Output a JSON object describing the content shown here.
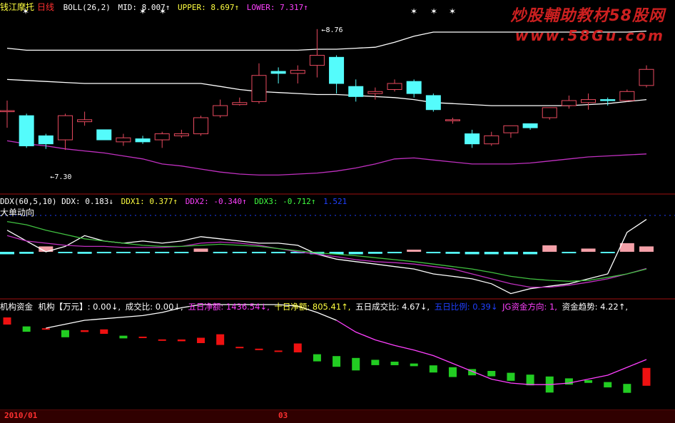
{
  "colors": {
    "background": "#000000",
    "up_candle": "#e84a5f",
    "down_candle": "#54fcfc",
    "white_line": "#ffffff",
    "magenta_line": "#c030c0",
    "green_line": "#40c040",
    "pink_line": "#ff40ff",
    "yellow_star": "#ffffff",
    "panel_divider": "#a01010",
    "label_white": "#ffffff",
    "label_red": "#ff3030",
    "label_yellow": "#ffff40",
    "label_magenta": "#ff40ff",
    "label_green": "#40ff40",
    "label_blue": "#2040ff",
    "watermark": "#cc2020",
    "bar_green": "#22cc22",
    "bar_red": "#ee1111"
  },
  "watermark": {
    "line1": "炒股輔助教材58股网",
    "line2": "www.58Gu.com"
  },
  "panel1": {
    "name_a": "钱江摩托",
    "name_b": "日线",
    "boll_label": "BOLL(26,2)",
    "mid_label": "MID: 8.007↑",
    "upper_label": "UPPER: 8.697↑",
    "lower_label": "LOWER: 7.317↑",
    "high_annotation": "8.76",
    "low_annotation": "7.30"
  },
  "panel2": {
    "ddx_label": "DDX(60,5,10) DDX: 0.183↓",
    "ddx1_label": "DDX1: 0.377↑",
    "ddx2_label": "DDX2: -0.340↑",
    "ddx3_label": "DDX3: -0.712↑",
    "ddx_tail": "1.521",
    "sub_title": "大单动向"
  },
  "panel3": {
    "title_a": "机构资金",
    "title_b": "机构【万元】: 0.00↓,",
    "chengjiao": "成交比: 0.00↓,",
    "five_day_net": "五日净额: 1436.54↓,",
    "ten_day_net": "十日净额: 805.41↑,",
    "five_day_ratio": "五日成交比: 4.67↓,",
    "five_day_pct": "五日比例: 0.39↓",
    "direction": "JG资金方向: 1,",
    "trend": "资金趋势: 4.22↑,"
  },
  "axis": {
    "date_start": "2010/01",
    "date_mid": "03"
  },
  "chart_data": [
    {
      "type": "candlestick",
      "title": "钱江摩托 日线 BOLL(26,2)",
      "candles": [
        {
          "o": 7.95,
          "h": 8.05,
          "l": 7.78,
          "c": 7.95
        },
        {
          "o": 7.9,
          "h": 7.92,
          "l": 7.58,
          "c": 7.6
        },
        {
          "o": 7.7,
          "h": 7.72,
          "l": 7.57,
          "c": 7.62
        },
        {
          "o": 7.66,
          "h": 7.92,
          "l": 7.56,
          "c": 7.9
        },
        {
          "o": 7.84,
          "h": 7.94,
          "l": 7.8,
          "c": 7.86
        },
        {
          "o": 7.76,
          "h": 7.76,
          "l": 7.66,
          "c": 7.66
        },
        {
          "o": 7.64,
          "h": 7.72,
          "l": 7.6,
          "c": 7.68
        },
        {
          "o": 7.67,
          "h": 7.7,
          "l": 7.62,
          "c": 7.64
        },
        {
          "o": 7.66,
          "h": 7.74,
          "l": 7.58,
          "c": 7.72
        },
        {
          "o": 7.7,
          "h": 7.76,
          "l": 7.68,
          "c": 7.72
        },
        {
          "o": 7.72,
          "h": 7.9,
          "l": 7.7,
          "c": 7.88
        },
        {
          "o": 7.9,
          "h": 8.06,
          "l": 7.88,
          "c": 8.0
        },
        {
          "o": 8.01,
          "h": 8.08,
          "l": 8.0,
          "c": 8.03
        },
        {
          "o": 8.04,
          "h": 8.42,
          "l": 8.02,
          "c": 8.3
        },
        {
          "o": 8.34,
          "h": 8.38,
          "l": 8.22,
          "c": 8.32
        },
        {
          "o": 8.32,
          "h": 8.4,
          "l": 8.22,
          "c": 8.35
        },
        {
          "o": 8.4,
          "h": 8.76,
          "l": 8.28,
          "c": 8.5
        },
        {
          "o": 8.48,
          "h": 8.5,
          "l": 8.12,
          "c": 8.22
        },
        {
          "o": 8.19,
          "h": 8.26,
          "l": 8.04,
          "c": 8.09
        },
        {
          "o": 8.12,
          "h": 8.18,
          "l": 8.06,
          "c": 8.14
        },
        {
          "o": 8.16,
          "h": 8.26,
          "l": 8.14,
          "c": 8.22
        },
        {
          "o": 8.24,
          "h": 8.26,
          "l": 8.08,
          "c": 8.12
        },
        {
          "o": 8.1,
          "h": 8.12,
          "l": 7.94,
          "c": 7.96
        },
        {
          "o": 7.86,
          "h": 7.88,
          "l": 7.82,
          "c": 7.86
        },
        {
          "o": 7.72,
          "h": 7.76,
          "l": 7.58,
          "c": 7.62
        },
        {
          "o": 7.62,
          "h": 7.74,
          "l": 7.6,
          "c": 7.7
        },
        {
          "o": 7.73,
          "h": 7.8,
          "l": 7.68,
          "c": 7.8
        },
        {
          "o": 7.82,
          "h": 7.82,
          "l": 7.76,
          "c": 7.78
        },
        {
          "o": 7.88,
          "h": 7.98,
          "l": 7.86,
          "c": 7.98
        },
        {
          "o": 8.0,
          "h": 8.1,
          "l": 7.97,
          "c": 8.05
        },
        {
          "o": 8.03,
          "h": 8.12,
          "l": 7.96,
          "c": 8.06
        },
        {
          "o": 8.06,
          "h": 8.08,
          "l": 8.0,
          "c": 8.05
        },
        {
          "o": 8.05,
          "h": 8.16,
          "l": 8.04,
          "c": 8.14
        },
        {
          "o": 8.2,
          "h": 8.4,
          "l": 8.18,
          "c": 8.36
        }
      ],
      "boll_upper": [
        8.57,
        8.55,
        8.55,
        8.55,
        8.55,
        8.55,
        8.55,
        8.55,
        8.55,
        8.55,
        8.55,
        8.55,
        8.55,
        8.55,
        8.55,
        8.55,
        8.56,
        8.56,
        8.57,
        8.58,
        8.63,
        8.69,
        8.73,
        8.73,
        8.73,
        8.73,
        8.73,
        8.73,
        8.73,
        8.73,
        8.73,
        8.73,
        8.73,
        8.74
      ],
      "boll_mid": [
        8.26,
        8.25,
        8.24,
        8.23,
        8.22,
        8.22,
        8.22,
        8.22,
        8.22,
        8.22,
        8.22,
        8.19,
        8.16,
        8.14,
        8.13,
        8.12,
        8.11,
        8.11,
        8.1,
        8.09,
        8.08,
        8.06,
        8.03,
        8.02,
        8.01,
        8.0,
        8.0,
        8.0,
        8.0,
        8.0,
        8.01,
        8.02,
        8.04,
        8.06
      ],
      "boll_lower": [
        7.65,
        7.62,
        7.6,
        7.57,
        7.55,
        7.53,
        7.5,
        7.47,
        7.42,
        7.4,
        7.37,
        7.34,
        7.32,
        7.31,
        7.31,
        7.32,
        7.33,
        7.35,
        7.38,
        7.42,
        7.47,
        7.48,
        7.46,
        7.44,
        7.42,
        7.42,
        7.42,
        7.43,
        7.45,
        7.47,
        7.49,
        7.5,
        7.51,
        7.52
      ]
    },
    {
      "type": "line",
      "title": "DDX(60,5,10)",
      "series": [
        {
          "name": "DDX",
          "kind": "bar",
          "values": [
            -0.05,
            -0.04,
            0.05,
            -0.02,
            -0.04,
            -0.03,
            -0.02,
            -0.01,
            -0.01,
            -0.01,
            0.03,
            -0.03,
            -0.02,
            -0.03,
            -0.03,
            -0.03,
            -0.05,
            -0.05,
            -0.05,
            -0.04,
            -0.03,
            0.02,
            -0.03,
            -0.04,
            -0.05,
            -0.05,
            -0.05,
            -0.05,
            0.06,
            -0.03,
            0.03,
            -0.02,
            0.08,
            0.05
          ]
        },
        {
          "name": "DDX1",
          "values": [
            0.2,
            0.1,
            0.0,
            0.05,
            0.15,
            0.1,
            0.08,
            0.1,
            0.08,
            0.1,
            0.14,
            0.12,
            0.1,
            0.08,
            0.08,
            0.06,
            -0.05,
            -0.15,
            -0.2,
            -0.25,
            -0.3,
            -0.35,
            -0.45,
            -0.5,
            -0.55,
            -0.65,
            -0.85,
            -0.75,
            -0.7,
            -0.65,
            -0.55,
            -0.45,
            0.18,
            0.3
          ]
        },
        {
          "name": "DDX2",
          "values": [
            0.15,
            0.1,
            0.08,
            0.06,
            0.05,
            0.05,
            0.04,
            0.04,
            0.04,
            0.05,
            0.08,
            0.09,
            0.08,
            0.06,
            0.03,
            0.0,
            -0.05,
            -0.1,
            -0.16,
            -0.2,
            -0.22,
            -0.25,
            -0.3,
            -0.35,
            -0.45,
            -0.55,
            -0.65,
            -0.72,
            -0.72,
            -0.68,
            -0.62,
            -0.55,
            -0.45,
            -0.34
          ]
        },
        {
          "name": "DDX3",
          "values": [
            0.28,
            0.25,
            0.2,
            0.16,
            0.12,
            0.1,
            0.08,
            0.06,
            0.05,
            0.05,
            0.06,
            0.07,
            0.06,
            0.05,
            0.03,
            0.01,
            -0.02,
            -0.05,
            -0.08,
            -0.12,
            -0.16,
            -0.2,
            -0.25,
            -0.3,
            -0.35,
            -0.42,
            -0.5,
            -0.55,
            -0.58,
            -0.6,
            -0.58,
            -0.52,
            -0.45,
            -0.35
          ]
        }
      ]
    },
    {
      "type": "bar",
      "title": "机构资金",
      "bars": [
        0.4,
        -0.3,
        0.0,
        -0.4,
        0.1,
        0.25,
        -0.15,
        0.05,
        0.0,
        0.1,
        0.3,
        0.6,
        0.0,
        0.0,
        0.0,
        0.5,
        -0.4,
        -0.6,
        -0.7,
        -0.3,
        -0.2,
        -0.15,
        -0.4,
        -0.55,
        -0.35,
        -0.3,
        -0.45,
        -0.6,
        -0.9,
        -0.35,
        -0.15,
        -0.3,
        -0.5,
        1.0
      ],
      "line": [
        0.0,
        0.05,
        0.1,
        0.12,
        0.14,
        0.16,
        0.2,
        0.26,
        0.3,
        0.3,
        0.3,
        0.3,
        0.3,
        0.28,
        0.2,
        0.1,
        -0.05,
        -0.15,
        -0.22,
        -0.28,
        -0.35,
        -0.45,
        -0.55,
        -0.65,
        -0.7,
        -0.72,
        -0.72,
        -0.7,
        -0.65,
        -0.6,
        -0.5,
        -0.4
      ]
    }
  ]
}
